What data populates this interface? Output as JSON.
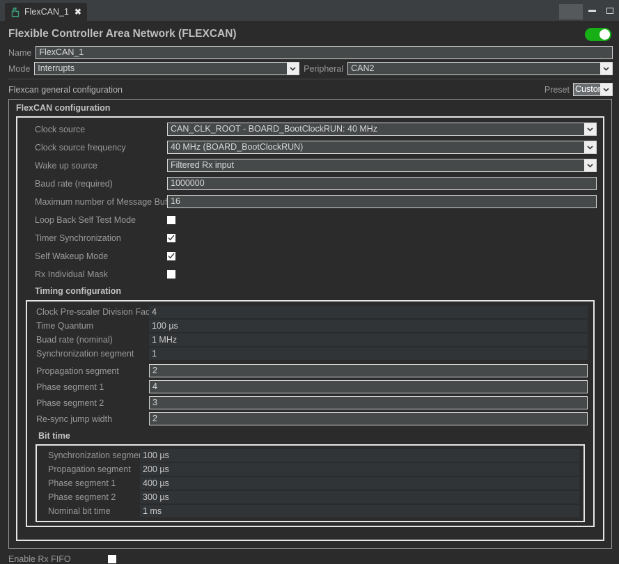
{
  "window": {
    "tab_label": "FlexCAN_1",
    "tab_icon": "component-icon",
    "close_icon": "close-icon",
    "minimize_icon": "minimize-icon",
    "maximize_icon": "maximize-icon"
  },
  "header": {
    "title": "Flexible Controller Area Network (FLEXCAN)",
    "enable_toggle": {
      "state": "on",
      "color": "#16b016"
    },
    "name_label": "Name",
    "name_value": "FlexCAN_1",
    "mode_label": "Mode",
    "mode_value": "Interrupts",
    "peripheral_label": "Peripheral",
    "peripheral_value": "CAN2"
  },
  "general": {
    "section_title": "Flexcan general configuration",
    "preset_label": "Preset",
    "preset_value": "Custom"
  },
  "flexcan_config": {
    "title": "FlexCAN configuration",
    "fields": [
      {
        "label": "Clock source",
        "value": "CAN_CLK_ROOT - BOARD_BootClockRUN: 40 MHz",
        "type": "combo"
      },
      {
        "label": "Clock source frequency",
        "value": "40 MHz (BOARD_BootClockRUN)",
        "type": "combo"
      },
      {
        "label": "Wake up source",
        "value": "Filtered Rx input",
        "type": "combo"
      },
      {
        "label": "Baud rate (required)",
        "value": "1000000",
        "type": "text"
      },
      {
        "label": "Maximum number of Message Buffers",
        "value": "16",
        "type": "text"
      }
    ],
    "checkboxes": [
      {
        "label": "Loop Back Self Test Mode",
        "checked": false
      },
      {
        "label": "Timer Synchronization",
        "checked": true
      },
      {
        "label": "Self Wakeup Mode",
        "checked": true
      },
      {
        "label": "Rx Individual Mask",
        "checked": false
      }
    ]
  },
  "timing": {
    "title": "Timing configuration",
    "readonly_rows": [
      {
        "label": "Clock Pre-scaler Division Factor",
        "value": "4"
      },
      {
        "label": "Time Quantum",
        "value": "100 µs"
      },
      {
        "label": "Buad rate (nominal)",
        "value": "1 MHz"
      },
      {
        "label": "Synchronization segment",
        "value": "1"
      }
    ],
    "editable_rows": [
      {
        "label": "Propagation segment",
        "value": "2"
      },
      {
        "label": "Phase segment 1",
        "value": "4"
      },
      {
        "label": "Phase segment 2",
        "value": "3"
      },
      {
        "label": "Re-sync jump width",
        "value": "2"
      }
    ]
  },
  "bit_time": {
    "title": "Bit time",
    "rows": [
      {
        "label": "Synchronization segment",
        "value": "100 µs"
      },
      {
        "label": "Propagation segment",
        "value": "200 µs"
      },
      {
        "label": "Phase segment 1",
        "value": "400 µs"
      },
      {
        "label": "Phase segment 2",
        "value": "300 µs"
      },
      {
        "label": "Nominal bit time",
        "value": "1 ms"
      }
    ]
  },
  "footer": {
    "rx_fifo_label": "Enable Rx FIFO",
    "rx_fifo_checked": false
  }
}
